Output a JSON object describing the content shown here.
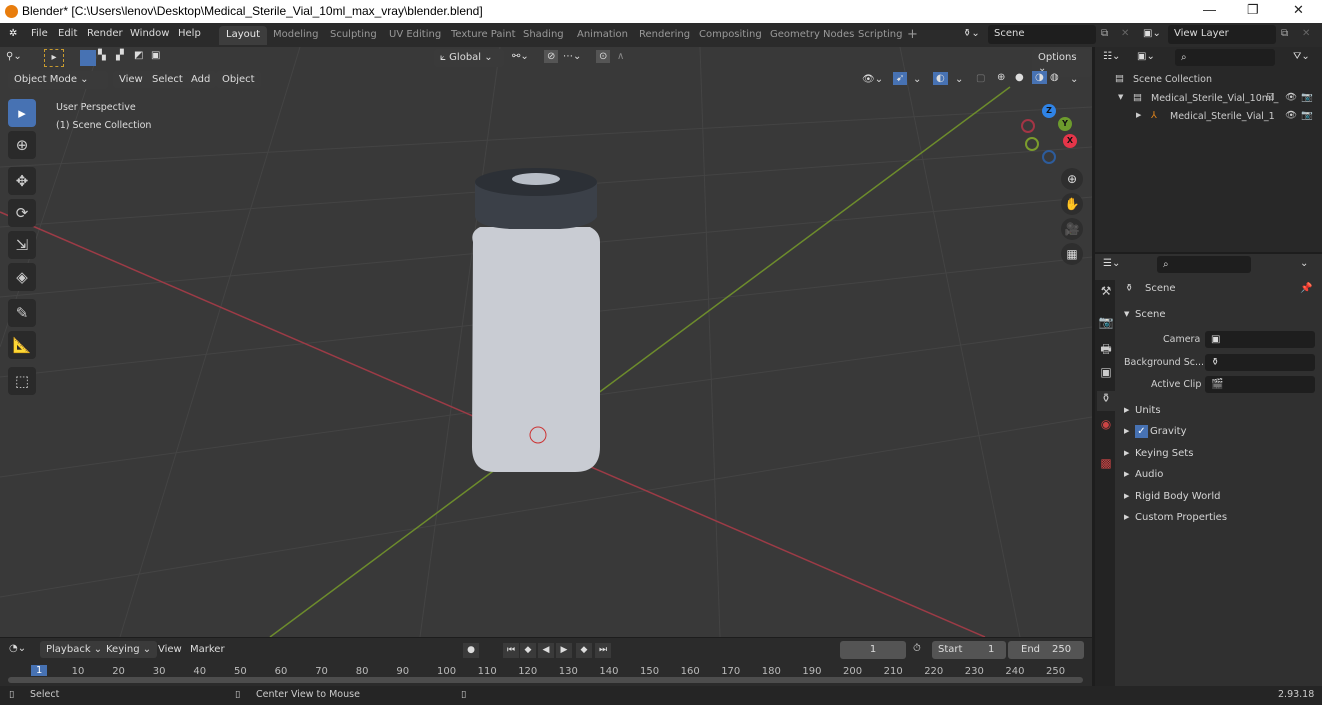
{
  "window": {
    "title": "Blender* [C:\\Users\\lenov\\Desktop\\Medical_Sterile_Vial_10ml_max_vray\\blender.blend]",
    "minimize": "—",
    "restore": "❐",
    "close": "✕"
  },
  "menu": [
    "File",
    "Edit",
    "Render",
    "Window",
    "Help"
  ],
  "workspaces": [
    "Layout",
    "Modeling",
    "Sculpting",
    "UV Editing",
    "Texture Paint",
    "Shading",
    "Animation",
    "Rendering",
    "Compositing",
    "Geometry Nodes",
    "Scripting",
    "+"
  ],
  "active_workspace": "Layout",
  "scene": {
    "label": "Scene",
    "view_layer": "View Layer"
  },
  "viewport_header": {
    "mode": "Object Mode",
    "menus": [
      "View",
      "Select",
      "Add",
      "Object"
    ],
    "orientation": "Global",
    "options": "Options"
  },
  "viewport": {
    "perspective": "User Perspective",
    "collection": "(1) Scene Collection"
  },
  "gizmo": {
    "x": "X",
    "y": "Y",
    "z": "Z"
  },
  "outliner": {
    "items": [
      {
        "label": "Scene Collection",
        "level": 0
      },
      {
        "label": "Medical_Sterile_Vial_10ml_",
        "level": 1
      },
      {
        "label": "Medical_Sterile_Vial_1",
        "level": 2
      }
    ]
  },
  "properties": {
    "header": "Scene",
    "panel": "Scene",
    "fields": [
      {
        "label": "Camera",
        "value": ""
      },
      {
        "label": "Background Sc...",
        "value": ""
      },
      {
        "label": "Active Clip",
        "value": ""
      }
    ],
    "sections": [
      "Units",
      "Gravity",
      "Keying Sets",
      "Audio",
      "Rigid Body World",
      "Custom Properties"
    ],
    "gravity_checked": true
  },
  "timeline": {
    "menus": [
      "Playback",
      "Keying",
      "View",
      "Marker"
    ],
    "current_frame": "1",
    "start_label": "Start",
    "start": "1",
    "end_label": "End",
    "end": "250",
    "ticks": [
      "1",
      "10",
      "20",
      "30",
      "40",
      "50",
      "60",
      "70",
      "80",
      "90",
      "100",
      "110",
      "120",
      "130",
      "140",
      "150",
      "160",
      "170",
      "180",
      "190",
      "200",
      "210",
      "220",
      "230",
      "240",
      "250"
    ]
  },
  "status": {
    "left": "Select",
    "middle": "Center View to Mouse",
    "version": "2.93.18"
  }
}
